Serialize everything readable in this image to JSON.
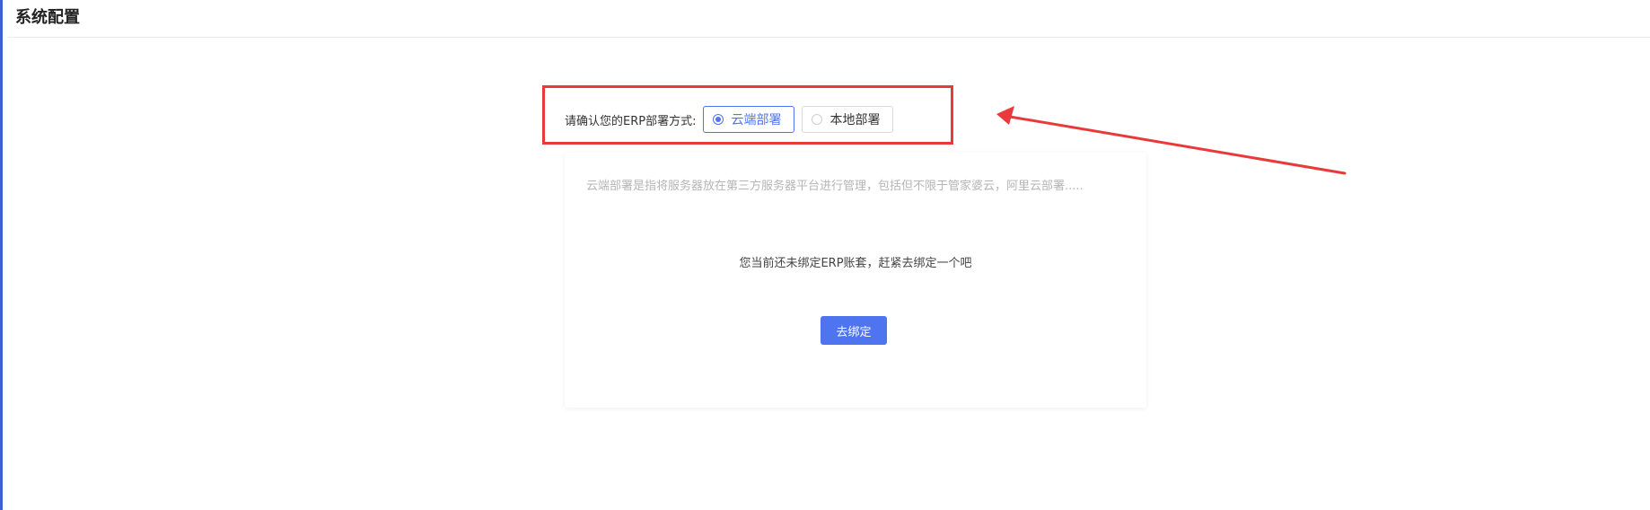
{
  "header": {
    "title": "系统配置"
  },
  "deploy": {
    "label": "请确认您的ERP部署方式:",
    "options": [
      {
        "label": "云端部署",
        "selected": true
      },
      {
        "label": "本地部署",
        "selected": false
      }
    ]
  },
  "card": {
    "description": "云端部署是指将服务器放在第三方服务器平台进行管理，包括但不限于管家婆云，阿里云部署.....",
    "message": "您当前还未绑定ERP账套，赶紧去绑定一个吧",
    "bind_button_label": "去绑定"
  },
  "colors": {
    "accent": "#4e74f0",
    "annotation": "#e83a3a"
  }
}
